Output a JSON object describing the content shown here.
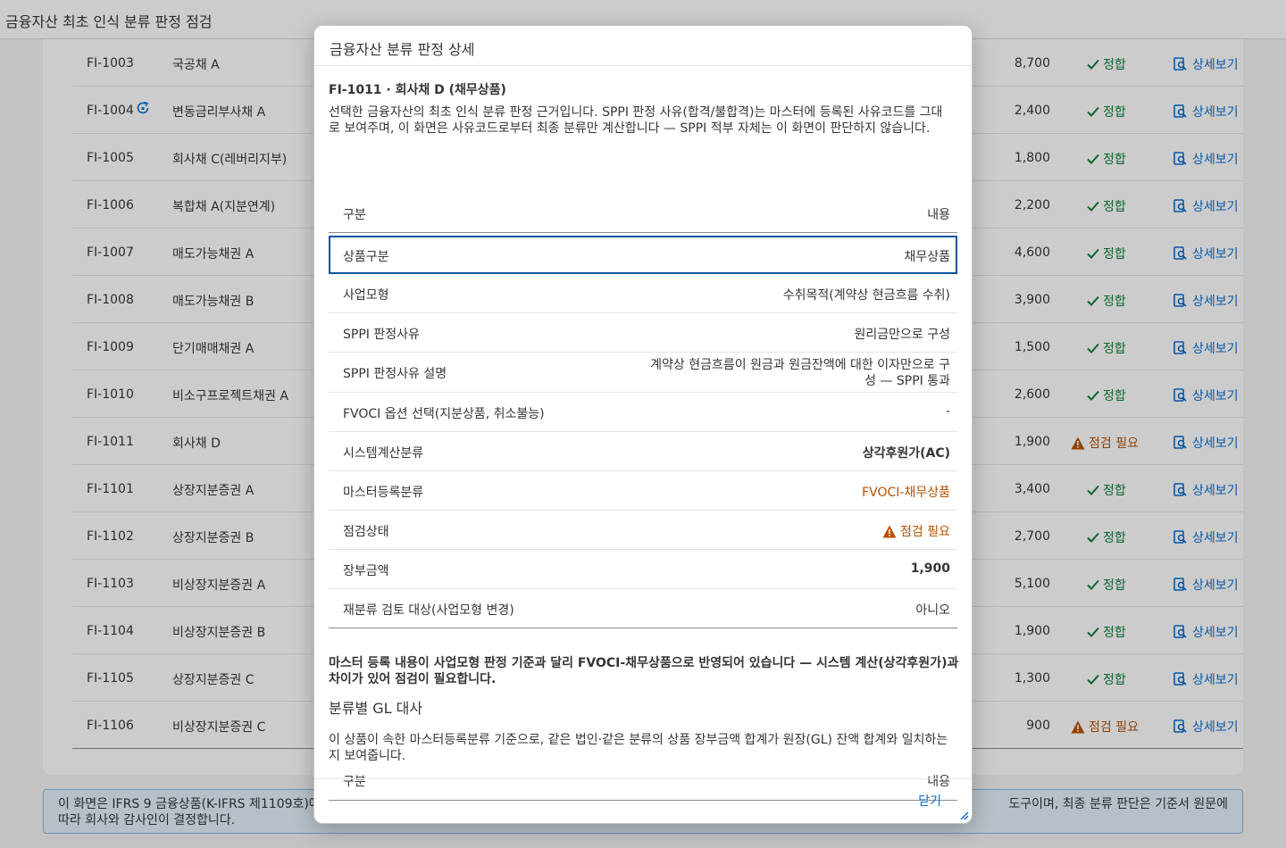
{
  "app": {
    "title": "금융자산 최초 인식 분류 판정 점검"
  },
  "table": {
    "rows": [
      {
        "id": "FI-1003",
        "name": "국공채 A",
        "amount": "8,700",
        "status": "정합",
        "status_type": "ok",
        "link": "상세보기",
        "has_refresh_icon": false
      },
      {
        "id": "FI-1004",
        "name": "변동금리부사채 A",
        "amount": "2,400",
        "status": "정합",
        "status_type": "ok",
        "link": "상세보기",
        "has_refresh_icon": true
      },
      {
        "id": "FI-1005",
        "name": "회사채 C(레버리지부)",
        "amount": "1,800",
        "status": "정합",
        "status_type": "ok",
        "link": "상세보기",
        "has_refresh_icon": false
      },
      {
        "id": "FI-1006",
        "name": "복합채 A(지분연계)",
        "amount": "2,200",
        "status": "정합",
        "status_type": "ok",
        "link": "상세보기",
        "has_refresh_icon": false
      },
      {
        "id": "FI-1007",
        "name": "매도가능채권 A",
        "amount": "4,600",
        "status": "정합",
        "status_type": "ok",
        "link": "상세보기",
        "has_refresh_icon": false
      },
      {
        "id": "FI-1008",
        "name": "매도가능채권 B",
        "amount": "3,900",
        "status": "정합",
        "status_type": "ok",
        "link": "상세보기",
        "has_refresh_icon": false
      },
      {
        "id": "FI-1009",
        "name": "단기매매채권 A",
        "amount": "1,500",
        "status": "정합",
        "status_type": "ok",
        "link": "상세보기",
        "has_refresh_icon": false
      },
      {
        "id": "FI-1010",
        "name": "비소구프로젝트채권 A",
        "amount": "2,600",
        "status": "정합",
        "status_type": "ok",
        "link": "상세보기",
        "has_refresh_icon": false
      },
      {
        "id": "FI-1011",
        "name": "회사채 D",
        "amount": "1,900",
        "status": "점검 필요",
        "status_type": "warn",
        "link": "상세보기",
        "has_refresh_icon": false
      },
      {
        "id": "FI-1101",
        "name": "상장지분증권 A",
        "amount": "3,400",
        "status": "정합",
        "status_type": "ok",
        "link": "상세보기",
        "has_refresh_icon": false
      },
      {
        "id": "FI-1102",
        "name": "상장지분증권 B",
        "amount": "2,700",
        "status": "정합",
        "status_type": "ok",
        "link": "상세보기",
        "has_refresh_icon": false
      },
      {
        "id": "FI-1103",
        "name": "비상장지분증권 A",
        "amount": "5,100",
        "status": "정합",
        "status_type": "ok",
        "link": "상세보기",
        "has_refresh_icon": false
      },
      {
        "id": "FI-1104",
        "name": "비상장지분증권 B",
        "amount": "1,900",
        "status": "정합",
        "status_type": "ok",
        "link": "상세보기",
        "has_refresh_icon": false
      },
      {
        "id": "FI-1105",
        "name": "상장지분증권 C",
        "amount": "1,300",
        "status": "정합",
        "status_type": "ok",
        "link": "상세보기",
        "has_refresh_icon": false
      },
      {
        "id": "FI-1106",
        "name": "비상장지분증권 C",
        "amount": "900",
        "status": "점검 필요",
        "status_type": "warn",
        "link": "상세보기",
        "has_refresh_icon": false
      }
    ]
  },
  "info_strip": {
    "text_left": "이 화면은 IFRS 9 금융상품(K-IFRS 제1109호)에",
    "text_right": "도구이며, 최종 분류 판단은 기준서 원문에",
    "text_line2": "따라 회사와 감사인이 결정합니다."
  },
  "dialog": {
    "title": "금융자산 분류 판정 상세",
    "section_title": "FI-1011 · 회사채 D (채무상품)",
    "section_desc": "선택한 금융자산의 최초 인식 분류 판정 근거입니다. SPPI 판정 사유(합격/불합격)는 마스터에 등록된 사유코드를 그대로 보여주며, 이 화면은 사유코드로부터 최종 분류만 계산합니다 — SPPI 적부 자체는 이 화면이 판단하지 않습니다.",
    "detail_header": {
      "key": "구분",
      "value": "내용"
    },
    "details": [
      {
        "key": "상품구분",
        "value": "채무상품"
      },
      {
        "key": "사업모형",
        "value": "수취목적(계약상 현금흐름 수취)"
      },
      {
        "key": "SPPI 판정사유",
        "value": "원리금만으로 구성"
      },
      {
        "key": "SPPI 판정사유 설명",
        "value": "계약상 현금흐름이 원금과 원금잔액에 대한 이자만으로 구성 — SPPI 통과"
      },
      {
        "key": "FVOCI 옵션 선택(지분상품, 취소불능)",
        "value": "-"
      },
      {
        "key": "시스템계산분류",
        "value": "상각후원가(AC)"
      },
      {
        "key": "마스터등록분류",
        "value": "FVOCI-채무상품"
      },
      {
        "key": "점검상태",
        "value": "점검 필요"
      },
      {
        "key": "장부금액",
        "value": "1,900"
      },
      {
        "key": "재분류 검토 대상(사업모형 변경)",
        "value": "아니오"
      }
    ],
    "note": "마스터 등록 내용이 사업모형 판정 기준과 달리 FVOCI-채무상품으로 반영되어 있습니다 — 시스템 계산(상각후원가)과 차이가 있어 점검이 필요합니다.",
    "gl_title": "분류별 GL 대사",
    "gl_desc": "이 상품이 속한 마스터등록분류 기준으로, 같은 법인·같은 분류의 상품 장부금액 합계가 원장(GL) 잔액 합계와 일치하는지 보여줍니다.",
    "gl_header": {
      "key": "구분",
      "value": "내용"
    },
    "close_label": "닫기"
  },
  "colors": {
    "accent": "#0a6ed1",
    "ok": "#107e3e",
    "warn": "#b95000",
    "selected_border": "#0854a0"
  },
  "icons": {
    "ok": "check-icon",
    "warn": "warning-icon",
    "link": "detail-view-icon",
    "refresh": "refresh-icon"
  }
}
